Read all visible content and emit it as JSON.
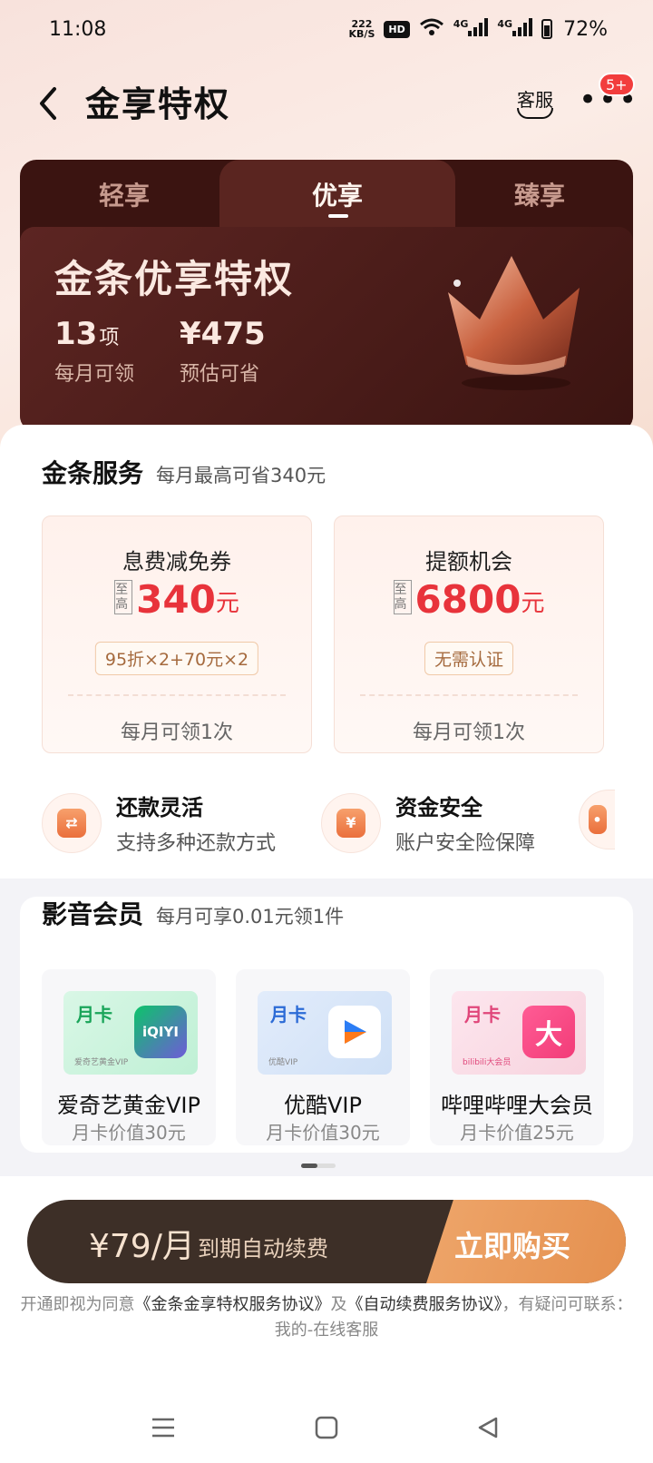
{
  "status_bar": {
    "time": "11:08",
    "speed_value": "222",
    "speed_unit": "KB/S",
    "hd": "HD",
    "signal_1": "4G",
    "signal_2": "4G",
    "battery": "72%"
  },
  "header": {
    "title": "金享特权",
    "service_label": "客服",
    "more_badge": "5+"
  },
  "member_card": {
    "tabs": [
      {
        "label": "轻享"
      },
      {
        "label": "优享"
      },
      {
        "label": "臻享"
      }
    ],
    "title": "金条优享特权",
    "stats": [
      {
        "value": "13",
        "unit": "项",
        "label": "每月可领"
      },
      {
        "value": "¥475",
        "unit": "",
        "label": "预估可省"
      }
    ]
  },
  "jintiao_service": {
    "title": "金条服务",
    "subtitle": "每月最高可省340元",
    "coupons": [
      {
        "title": "息费减免券",
        "upto": "至高",
        "amount": "340",
        "unit": "元",
        "tag": "95折×2+70元×2",
        "bottom": "每月可领1次"
      },
      {
        "title": "提额机会",
        "upto": "至高",
        "amount": "6800",
        "unit": "元",
        "tag": "无需认证",
        "bottom": "每月可领1次"
      }
    ],
    "features": [
      {
        "icon": "repay-icon",
        "title": "还款灵活",
        "subtitle": "支持多种还款方式"
      },
      {
        "icon": "yuan-shield-icon",
        "title": "资金安全",
        "subtitle": "账户安全险保障"
      }
    ]
  },
  "media": {
    "title": "影音会员",
    "subtitle": "每月可享0.01元领1件",
    "items": [
      {
        "thumb_label": "月卡",
        "thumb_small": "爱奇艺黄金VIP",
        "logo": "iQIYI",
        "name": "爱奇艺黄金VIP",
        "value": "月卡价值30元"
      },
      {
        "thumb_label": "月卡",
        "thumb_small": "优酷VIP",
        "logo": "",
        "name": "优酷VIP",
        "value": "月卡价值30元"
      },
      {
        "thumb_label": "月卡",
        "thumb_small": "bilibili大会员",
        "logo": "大",
        "name": "哔哩哔哩大会员",
        "value": "月卡价值25元"
      }
    ]
  },
  "purchase": {
    "price": "¥79/月",
    "note": "到期自动续费",
    "button": "立即购买",
    "agreement_prefix": "开通即视为同意",
    "agreement_link_1": "《金条金享特权服务协议》",
    "agreement_and": "及",
    "agreement_link_2": "《自动续费服务协议》",
    "agreement_suffix": "，有疑问可联系：我的-在线客服"
  },
  "colors": {
    "accent_red": "#e8333b",
    "card_dark": "#3b1411",
    "buy_orange": "#e38c4a"
  }
}
